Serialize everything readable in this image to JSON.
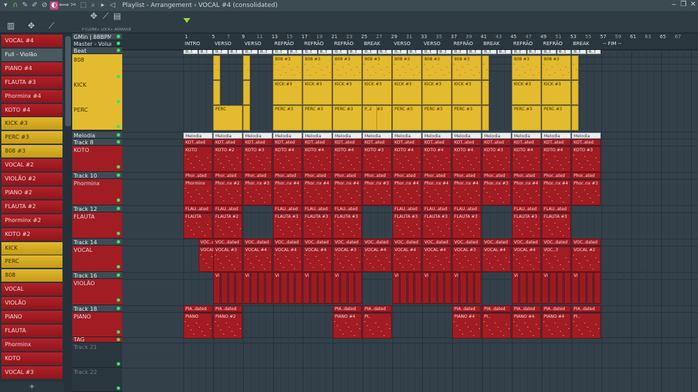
{
  "window": {
    "title": "Playlist - Arrangement › VOCAL #4 (consolidated)",
    "controls": [
      "‒",
      "❐",
      "✕"
    ]
  },
  "colors": {
    "pattern": "#a21c23",
    "audio": "#e3bb2e",
    "intro": "#56c643",
    "break": "#d63dbd",
    "refrao": "#b11822",
    "verso": "#e8c238",
    "led": "#3de26a"
  },
  "toolbar": {
    "icons": [
      "magnet-icon",
      "pencil-icon",
      "paint-icon",
      "delete-icon",
      "mute-icon",
      "slip-icon",
      "slice-icon",
      "select-icon",
      "zoom-icon",
      "play-icon",
      "speaker-icon"
    ],
    "picker_label": "P-CLONE+ LOCK+ ARRANGE"
  },
  "picker": {
    "items": [
      {
        "label": "VOCAL #4",
        "kind": "pat"
      },
      {
        "label": "Full - Violão",
        "kind": "sel"
      },
      {
        "label": "PIANO #4",
        "kind": "pat"
      },
      {
        "label": "FLAUTA #3",
        "kind": "pat"
      },
      {
        "label": "Phorminx #4",
        "kind": "pat"
      },
      {
        "label": "KOTO #4",
        "kind": "pat"
      },
      {
        "label": "KICK #3",
        "kind": "aud"
      },
      {
        "label": "PERC #3",
        "kind": "aud"
      },
      {
        "label": "808 #3",
        "kind": "aud"
      },
      {
        "label": "VOCAL #2",
        "kind": "pat"
      },
      {
        "label": "VIOLÃO #2",
        "kind": "pat"
      },
      {
        "label": "PIANO #2",
        "kind": "pat"
      },
      {
        "label": "FLAUTA #2",
        "kind": "pat"
      },
      {
        "label": "Phorminx #2",
        "kind": "pat"
      },
      {
        "label": "KOTO #2",
        "kind": "pat"
      },
      {
        "label": "KICK",
        "kind": "aud"
      },
      {
        "label": "PERC",
        "kind": "aud"
      },
      {
        "label": "808",
        "kind": "aud"
      },
      {
        "label": "VOCAL",
        "kind": "pat"
      },
      {
        "label": "VIOLÃO",
        "kind": "pat"
      },
      {
        "label": "PIANO",
        "kind": "pat"
      },
      {
        "label": "FLAUTA",
        "kind": "pat"
      },
      {
        "label": "Phorminx",
        "kind": "pat"
      },
      {
        "label": "KOTO",
        "kind": "pat"
      },
      {
        "label": "VOCAL #3",
        "kind": "pat"
      }
    ],
    "add_label": "+"
  },
  "tracks": {
    "key": "GMin | 88BPM",
    "master_volume": "Master - Volume",
    "beat": "Beat",
    "sub_808": "808",
    "sub_kick": "KICK",
    "sub_perc": "PERC",
    "melodia": "Melodia",
    "t8": "Track 8",
    "t8_sub": "KOTO",
    "t10": "Track 10",
    "t10_sub": "Phorminx",
    "t12": "Track 12",
    "t12_sub": "FLAUTA",
    "t14": "Track 14",
    "t14_sub": "VOCAL",
    "t16": "Track 16",
    "t16_sub": "VIOLÃO",
    "t18": "Track 18",
    "t18_sub": "PIANO",
    "tag": "TAG",
    "t21": "Track 21",
    "t22": "Track 22"
  },
  "ruler": {
    "bars": [
      "1",
      "5",
      "7",
      "9",
      "11",
      "13",
      "15",
      "17",
      "19",
      "21",
      "23",
      "25",
      "27",
      "29",
      "31",
      "33",
      "35",
      "37",
      "39",
      "41",
      "43",
      "45",
      "47",
      "49",
      "51",
      "53",
      "55",
      "57",
      "59",
      "61",
      "63",
      "65",
      "67"
    ],
    "markers": [
      "INTRO",
      "VERSO",
      "VERSO",
      "REFRÃO",
      "REFRÃO",
      "REFRÃO",
      "BREAK",
      "VERSO",
      "VERSO",
      "REFRÃO",
      "BREAK",
      "REFRÃO",
      "REFRÃO",
      "BREAK",
      "-- FIM --"
    ]
  },
  "clips": {
    "intro": "Intro",
    "verso": "Verso",
    "refrao": "Refrão",
    "break": "Break",
    "master": "Master - Volume",
    "b808": "808 #3",
    "kick": "KICK #3",
    "perc": "PERC #3",
    "perc1": "PERC",
    "p2": "P..2",
    "beat_short": "B..t",
    "melodia": "Melodia",
    "kot_ated": "KOT..ated",
    "koto": "KOTO",
    "koto2": "KOTO #2",
    "koto3": "KOTO #3",
    "koto4": "KOTO #4",
    "phor_ted": "Pho..ted",
    "phor_ated": "Phor..ated",
    "phorminx": "Phorminx",
    "phor2": "Phor..nx #2",
    "phor3": "Phor..nx #3",
    "phor4": "Phor..nx #4",
    "fla_ted": "FLA..ted",
    "flau_ated": "FLAU..ated",
    "flauta": "FLAUTA",
    "flauta2": "FLAUTA #2",
    "flauta3": "FLAUTA #3",
    "voc_d": "V..d)",
    "voc_dated": "VOC..dated",
    "voc_ted": "V...ted)",
    "vocal2": "VOCAL #2",
    "vocal3": "VOCAL #3",
    "vocal4": "VOCAL #4",
    "vocal3b": "VOC..3",
    "viol_ated": "VIOL..ated",
    "pia_dated": "PIA..dated",
    "piano": "PIANO",
    "piano2": "PIANO #2",
    "piano4": "PIANO #4",
    "pi": "PI..",
    "d": "..d)"
  }
}
